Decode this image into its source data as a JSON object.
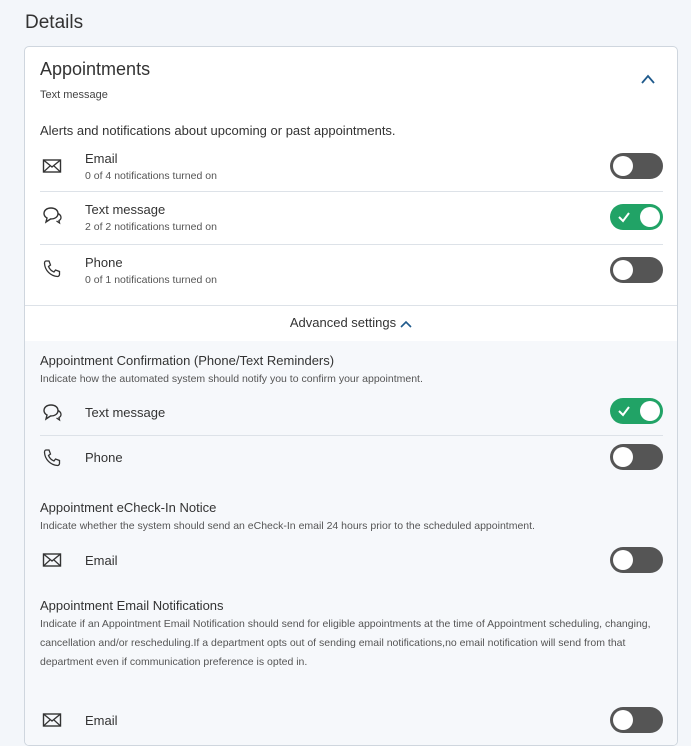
{
  "page": {
    "title": "Details"
  },
  "section": {
    "title": "Appointments",
    "subtitle": "Text message",
    "description": "Alerts and notifications about upcoming or past appointments."
  },
  "channels": [
    {
      "icon": "mail-icon",
      "label": "Email",
      "status": "0 of 4 notifications turned on",
      "enabled": false
    },
    {
      "icon": "chat-icon",
      "label": "Text message",
      "status": "2 of 2 notifications turned on",
      "enabled": true
    },
    {
      "icon": "phone-icon",
      "label": "Phone",
      "status": "0 of 1 notifications turned on",
      "enabled": false
    }
  ],
  "advanced": {
    "label": "Advanced settings",
    "groups": [
      {
        "title": "Appointment Confirmation (Phone/Text Reminders)",
        "description": "Indicate how the automated system should notify you to confirm your appointment.",
        "options": [
          {
            "icon": "chat-icon",
            "label": "Text message",
            "enabled": true
          },
          {
            "icon": "phone-icon",
            "label": "Phone",
            "enabled": false
          }
        ]
      },
      {
        "title": "Appointment eCheck-In Notice",
        "description": "Indicate whether the system should send an eCheck-In email 24 hours prior to the scheduled appointment.",
        "options": [
          {
            "icon": "mail-icon",
            "label": "Email",
            "enabled": false
          }
        ]
      },
      {
        "title": "Appointment Email Notifications",
        "description": "Indicate if an Appointment Email Notification should send for eligible appointments at the time of Appointment scheduling, changing, cancellation and/or rescheduling.If a department opts out of sending email notifications,no email notification will send from that department even if communication preference is opted in.",
        "options": [
          {
            "icon": "mail-icon",
            "label": "Email",
            "enabled": false
          }
        ]
      }
    ]
  },
  "colors": {
    "toggle_on": "#21a366",
    "toggle_off": "#555555",
    "panel_bg": "#f6f8fb"
  }
}
